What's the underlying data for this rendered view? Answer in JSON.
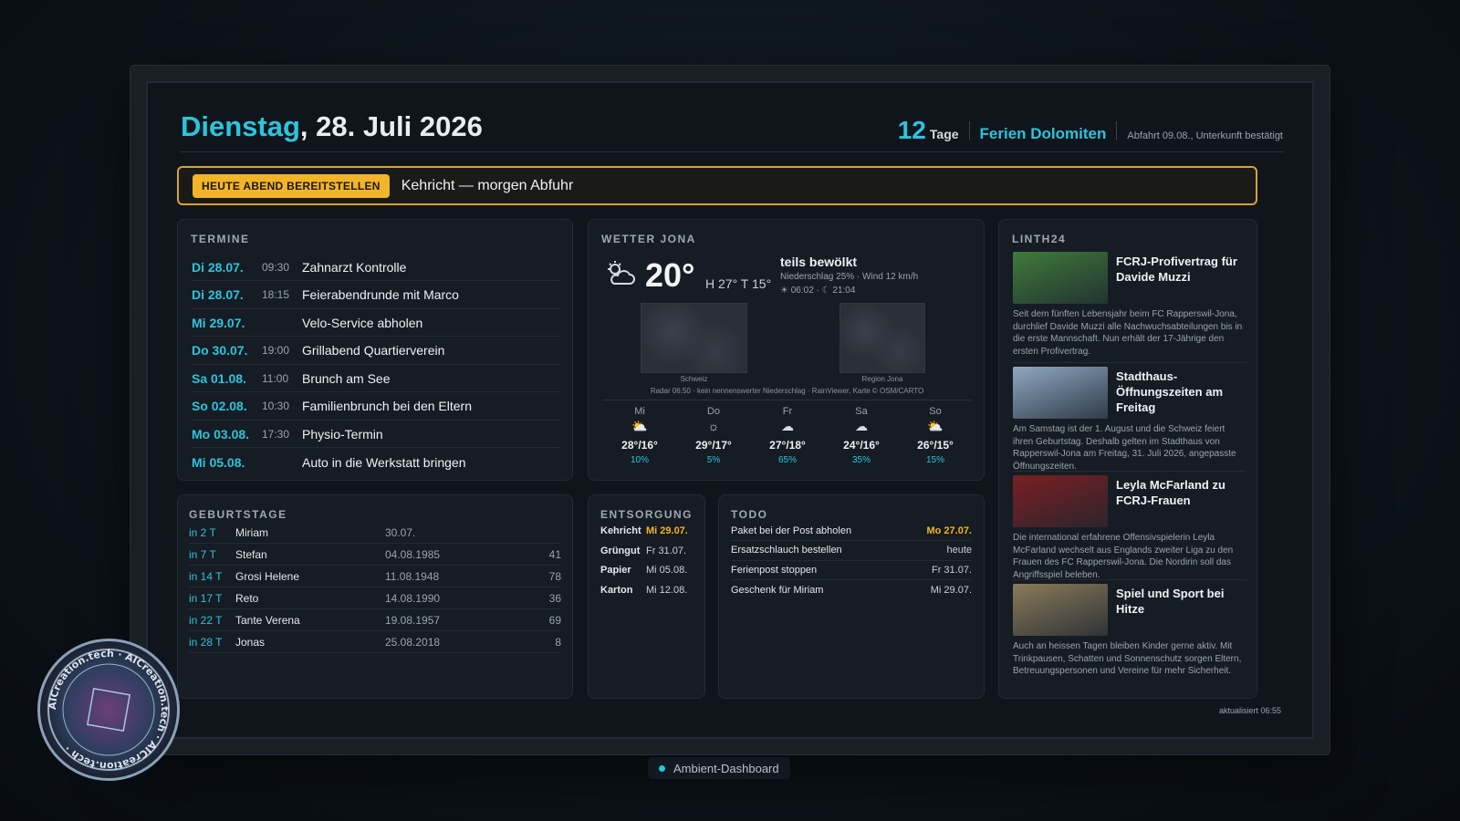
{
  "header": {
    "weekday": "Dienstag",
    "date": ", 28. Juli 2026",
    "countdown_days": "12",
    "countdown_unit": "Tage",
    "trip_title": "Ferien Dolomiten",
    "trip_note": "Abfahrt 09.08., Unterkunft bestätigt"
  },
  "alert": {
    "badge": "HEUTE ABEND BEREITSTELLEN",
    "text": "Kehricht — morgen Abfuhr"
  },
  "termine": {
    "title": "TERMINE",
    "items": [
      {
        "date": "Di 28.07.",
        "time": "09:30",
        "title": "Zahnarzt Kontrolle"
      },
      {
        "date": "Di 28.07.",
        "time": "18:15",
        "title": "Feierabendrunde mit Marco"
      },
      {
        "date": "Mi 29.07.",
        "time": "",
        "title": "Velo-Service abholen"
      },
      {
        "date": "Do 30.07.",
        "time": "19:00",
        "title": "Grillabend Quartierverein"
      },
      {
        "date": "Sa 01.08.",
        "time": "11:00",
        "title": "Brunch am See"
      },
      {
        "date": "So 02.08.",
        "time": "10:30",
        "title": "Familienbrunch bei den Eltern"
      },
      {
        "date": "Mo 03.08.",
        "time": "17:30",
        "title": "Physio-Termin"
      },
      {
        "date": "Mi 05.08.",
        "time": "",
        "title": "Auto in die Werkstatt bringen"
      }
    ]
  },
  "wetter": {
    "title": "WETTER JONA",
    "icon": "partly-cloudy-icon",
    "temp": "20°",
    "high_low": "H 27° T 15°",
    "condition": "teils bewölkt",
    "details": "Niederschlag 25% · Wind 12 km/h",
    "sun": "☀ 06:02 · ☾ 21:04",
    "radar_left_caption": "Schweiz",
    "radar_right_caption": "Region Jona",
    "radar_note": "Radar 06:50 · kein nennenswerter Niederschlag · RainViewer, Karte © OSM/CARTO",
    "forecast": [
      {
        "day": "Mi",
        "icon": "⛅",
        "temp": "28°/16°",
        "rain": "10%"
      },
      {
        "day": "Do",
        "icon": "☼",
        "temp": "29°/17°",
        "rain": "5%"
      },
      {
        "day": "Fr",
        "icon": "☁",
        "temp": "27°/18°",
        "rain": "65%"
      },
      {
        "day": "Sa",
        "icon": "☁",
        "temp": "24°/16°",
        "rain": "35%"
      },
      {
        "day": "So",
        "icon": "⛅",
        "temp": "26°/15°",
        "rain": "15%"
      }
    ]
  },
  "linth24": {
    "title": "LINTH24",
    "items": [
      {
        "title": "FCRJ-Profivertrag für Davide Muzzi",
        "body": "Seit dem fünften Lebensjahr beim FC Rapperswil-Jona, durchlief Davide Muzzi alle Nachwuchsabteilungen bis in die erste Mannschaft. Nun erhält der 17-Jährige den ersten Profivertrag.",
        "img_color": "#3f7a3a"
      },
      {
        "title": "Stadthaus-Öffnungszeiten am Freitag",
        "body": "Am Samstag ist der 1. August und die Schweiz feiert ihren Geburtstag. Deshalb gelten im Stadthaus von Rapperswil-Jona am Freitag, 31. Juli 2026, angepasste Öffnungszeiten.",
        "img_color": "#8fa8c2"
      },
      {
        "title": "Leyla McFarland zu FCRJ-Frauen",
        "body": "Die international erfahrene Offensivspielerin Leyla McFarland wechselt aus Englands zweiter Liga zu den Frauen des FC Rapperswil-Jona. Die Nordirin soll das Angriffsspiel beleben.",
        "img_color": "#7a1f22"
      },
      {
        "title": "Spiel und Sport bei Hitze",
        "body": "Auch an heissen Tagen bleiben Kinder gerne aktiv. Mit Trinkpausen, Schatten und Sonnenschutz sorgen Eltern, Betreuungspersonen und Vereine für mehr Sicherheit.",
        "img_color": "#8a7a5a"
      }
    ],
    "updated": "aktualisiert 06:55"
  },
  "geburtstage": {
    "title": "GEBURTSTAGE",
    "items": [
      {
        "in": "in 2 T",
        "name": "Miriam",
        "date": "30.07.",
        "age": ""
      },
      {
        "in": "in 7 T",
        "name": "Stefan",
        "date": "04.08.1985",
        "age": "41"
      },
      {
        "in": "in 14 T",
        "name": "Grosi Helene",
        "date": "11.08.1948",
        "age": "78"
      },
      {
        "in": "in 17 T",
        "name": "Reto",
        "date": "14.08.1990",
        "age": "36"
      },
      {
        "in": "in 22 T",
        "name": "Tante Verena",
        "date": "19.08.1957",
        "age": "69"
      },
      {
        "in": "in 28 T",
        "name": "Jonas",
        "date": "25.08.2018",
        "age": "8"
      }
    ]
  },
  "entsorgung": {
    "title": "ENTSORGUNG",
    "items": [
      {
        "type": "Kehricht",
        "date": "Mi 29.07."
      },
      {
        "type": "Grüngut",
        "date": "Fr 31.07."
      },
      {
        "type": "Papier",
        "date": "Mi 05.08."
      },
      {
        "type": "Karton",
        "date": "Mi 12.08."
      }
    ]
  },
  "todo": {
    "title": "TODO",
    "items": [
      {
        "text": "Paket bei der Post abholen",
        "due": "Mo 27.07."
      },
      {
        "text": "Ersatzschlauch bestellen",
        "due": "heute"
      },
      {
        "text": "Ferienpost stoppen",
        "due": "Fr 31.07."
      },
      {
        "text": "Geschenk für Miriam",
        "due": "Mi 29.07."
      }
    ]
  },
  "footer": {
    "label": "Ambient-Dashboard"
  },
  "watermark": {
    "text": "AICreation.tech"
  },
  "colors": {
    "accent": "#2cc4dd",
    "warning": "#f2b529",
    "background": "#10151c"
  }
}
